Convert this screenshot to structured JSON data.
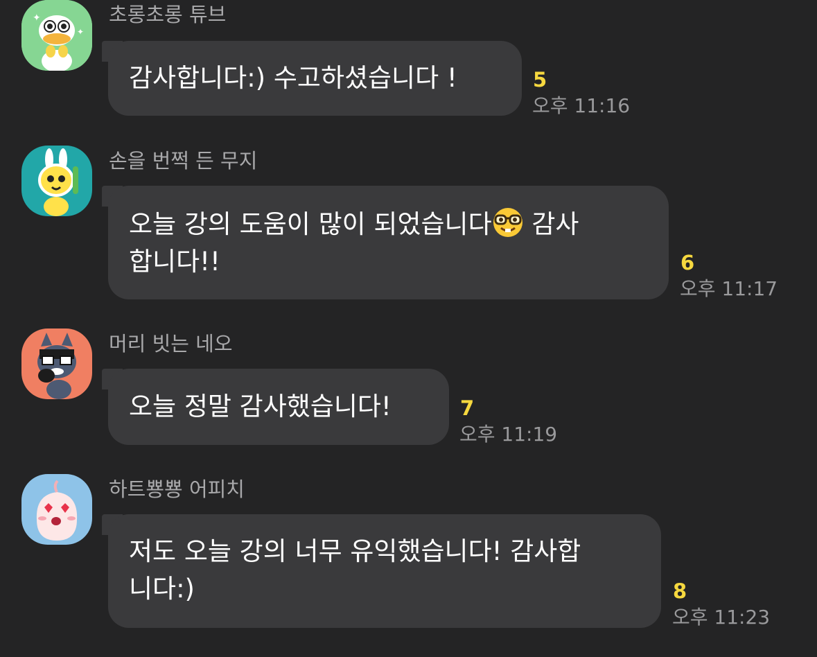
{
  "messages": [
    {
      "sender": "초롱초롱 튜브",
      "lines": [
        "감사합니다:) 수고하셨습니다 !"
      ],
      "unread": "5",
      "time": "오후 11:16"
    },
    {
      "sender": "손을 번쩍 든 무지",
      "lines": [
        "오늘 강의 도움이 많이 되었습니다",
        "감사",
        "합니다!!"
      ],
      "emoji": "nerd-face-emoji",
      "unread": "6",
      "time": "오후 11:17"
    },
    {
      "sender": "머리 빗는 네오",
      "lines": [
        "오늘 정말 감사했습니다!"
      ],
      "unread": "7",
      "time": "오후 11:19"
    },
    {
      "sender": "하트뿅뿅 어피치",
      "lines": [
        "저도 오늘 강의 너무 유익했습니다! 감사합",
        "니다:)"
      ],
      "unread": "8",
      "time": "오후 11:23"
    }
  ],
  "colors": {
    "background": "#242425",
    "bubble": "#3a3a3c",
    "unread": "#f6d83f"
  }
}
